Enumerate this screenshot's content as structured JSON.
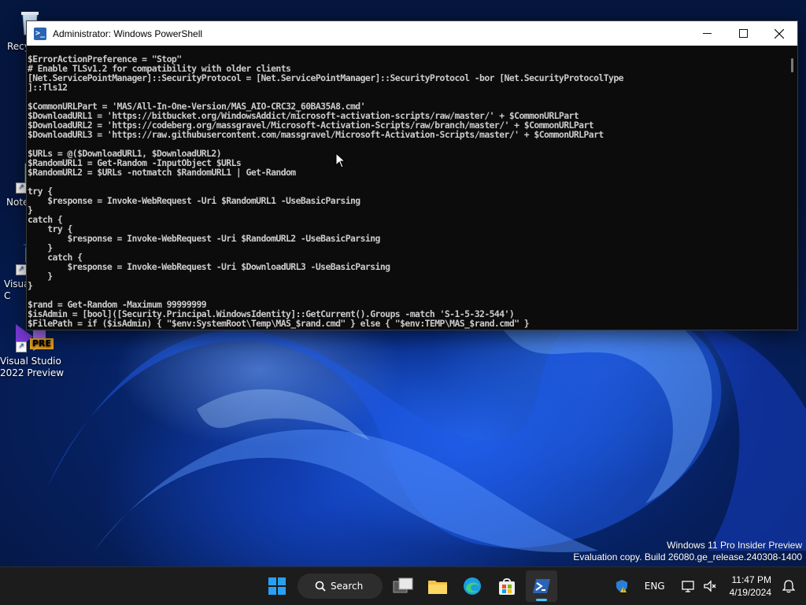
{
  "window": {
    "title": "Administrator: Windows PowerShell",
    "console_lines": [
      "$ErrorActionPreference = \"Stop\"",
      "# Enable TLSv1.2 for compatibility with older clients",
      "[Net.ServicePointManager]::SecurityProtocol = [Net.ServicePointManager]::SecurityProtocol -bor [Net.SecurityProtocolType",
      "]::Tls12",
      "",
      "$CommonURLPart = 'MAS/All-In-One-Version/MAS_AIO-CRC32_60BA35A8.cmd'",
      "$DownloadURL1 = 'https://bitbucket.org/WindowsAddict/microsoft-activation-scripts/raw/master/' + $CommonURLPart",
      "$DownloadURL2 = 'https://codeberg.org/massgravel/Microsoft-Activation-Scripts/raw/branch/master/' + $CommonURLPart",
      "$DownloadURL3 = 'https://raw.githubusercontent.com/massgravel/Microsoft-Activation-Scripts/master/' + $CommonURLPart",
      "",
      "$URLs = @($DownloadURL1, $DownloadURL2)",
      "$RandomURL1 = Get-Random -InputObject $URLs",
      "$RandomURL2 = $URLs -notmatch $RandomURL1 | Get-Random",
      "",
      "try {",
      "    $response = Invoke-WebRequest -Uri $RandomURL1 -UseBasicParsing",
      "}",
      "catch {",
      "    try {",
      "        $response = Invoke-WebRequest -Uri $RandomURL2 -UseBasicParsing",
      "    }",
      "    catch {",
      "        $response = Invoke-WebRequest -Uri $DownloadURL3 -UseBasicParsing",
      "    }",
      "}",
      "",
      "$rand = Get-Random -Maximum 99999999",
      "$isAdmin = [bool]([Security.Principal.WindowsIdentity]::GetCurrent().Groups -match 'S-1-5-32-544')",
      "$FilePath = if ($isAdmin) { \"$env:SystemRoot\\Temp\\MAS_$rand.cmd\" } else { \"$env:TEMP\\MAS_$rand.cmd\" }"
    ]
  },
  "desktop_icons": [
    {
      "label": "Recy",
      "icon": "recycle-bin-icon"
    },
    {
      "label": "Note",
      "icon": "notepad-icon"
    },
    {
      "label": "Visua\nC",
      "icon": "visual-studio-code-icon"
    },
    {
      "label": "Visual Studio\n2022 Preview",
      "icon": "visual-studio-preview-icon",
      "badge": "PRE"
    }
  ],
  "watermark": {
    "line1": "Windows 11 Pro Insider Preview",
    "line2": "Evaluation copy. Build 26080.ge_release.240308-1400"
  },
  "taskbar": {
    "search_label": "Search",
    "apps": [
      "start-icon",
      "task-view-icon",
      "file-explorer-icon",
      "edge-icon",
      "store-icon",
      "powershell-icon"
    ],
    "tray": {
      "language": "ENG",
      "time": "11:47 PM",
      "date": "4/19/2024"
    }
  },
  "colors": {
    "console_bg": "#0c0c0c",
    "console_fg": "#cccccc",
    "taskbar_bg": "#1c1c1c",
    "accent": "#4cc2ff"
  }
}
